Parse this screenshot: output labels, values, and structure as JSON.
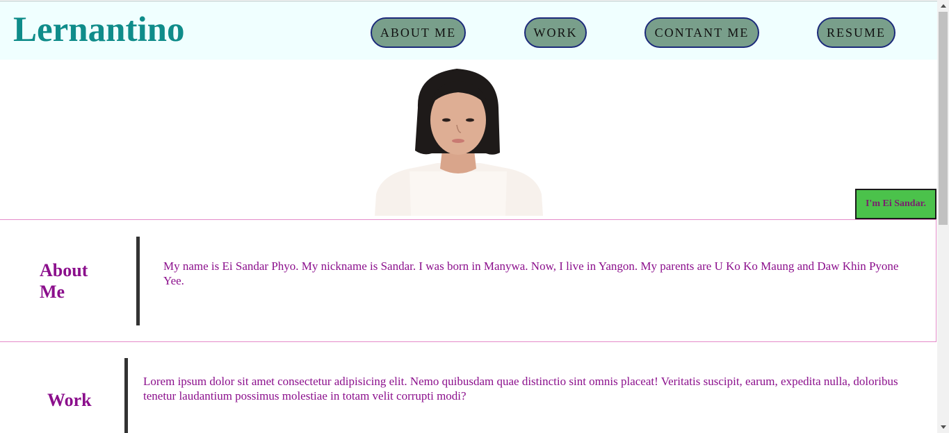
{
  "header": {
    "logo": "Lernantino",
    "nav": {
      "about": "ABOUT ME",
      "work": "WORK",
      "contact": "CONTANT ME",
      "resume": "RESUME"
    }
  },
  "hero": {
    "name_badge": "I'm Ei Sandar."
  },
  "about": {
    "title": "About Me",
    "text": "My name is Ei Sandar Phyo. My nickname is Sandar. I was born in Manywa. Now, I live in Yangon. My parents are U Ko Ko Maung and Daw Khin Pyone Yee."
  },
  "work": {
    "title": "Work",
    "text": "Lorem ipsum dolor sit amet consectetur adipisicing elit. Nemo quibusdam quae distinctio sint omnis placeat! Veritatis suscipit, earum, expedita nulla, doloribus tenetur laudantium possimus molestiae in totam velit corrupti modi?"
  },
  "colors": {
    "header_bg": "#f0ffff",
    "logo": "#0f8c8a",
    "nav_button_bg": "#799f8b",
    "nav_button_border": "#1b2a7a",
    "accent_text": "#8b0f8c",
    "badge_bg": "#4bc24b",
    "section_border": "#e48ac9"
  }
}
